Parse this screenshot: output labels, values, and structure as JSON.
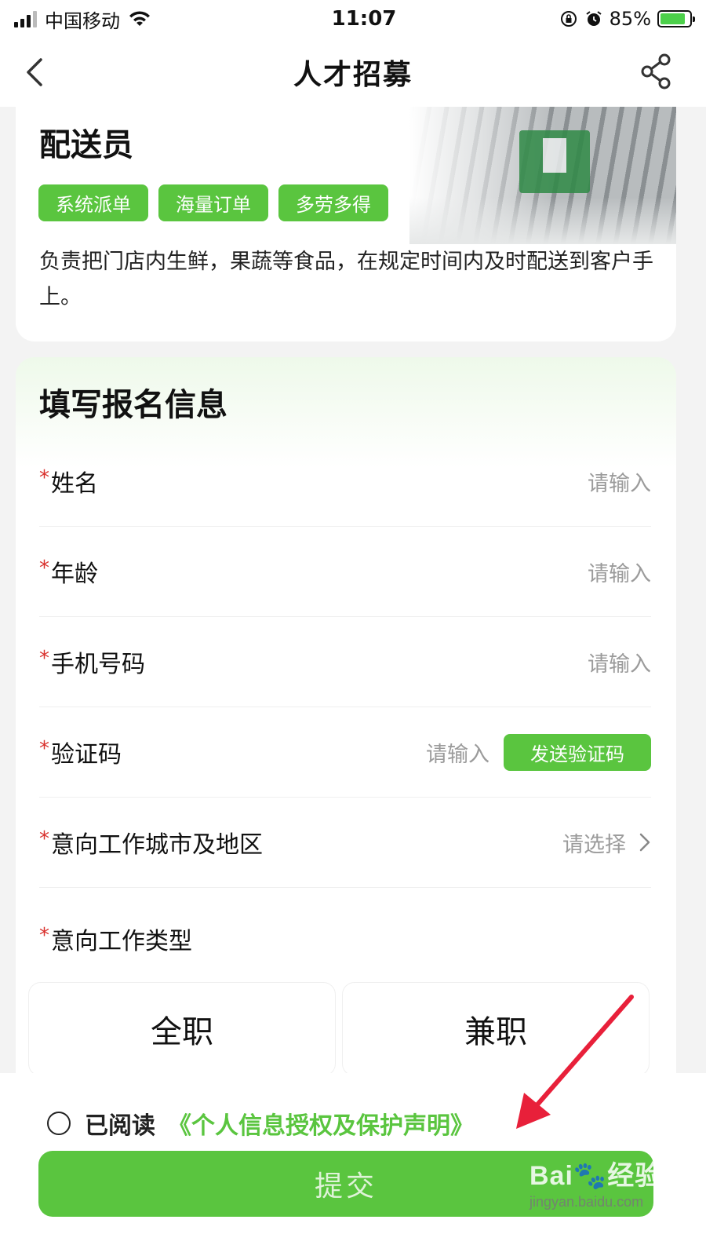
{
  "status_bar": {
    "carrier": "中国移动",
    "time": "11:07",
    "battery": "85%",
    "battery_level": 0.85
  },
  "nav": {
    "title": "人才招募",
    "back_icon": "chevron-left-icon",
    "share_icon": "share-icon"
  },
  "job": {
    "title": "配送员",
    "tags": [
      "系统派单",
      "海量订单",
      "多劳多得"
    ],
    "description": "负责把门店内生鲜，果蔬等食品，在规定时间内及时配送到客户手上。"
  },
  "form": {
    "title": "填写报名信息",
    "required_mark": "*",
    "fields": [
      {
        "label": "姓名",
        "placeholder": "请输入"
      },
      {
        "label": "年龄",
        "placeholder": "请输入"
      },
      {
        "label": "手机号码",
        "placeholder": "请输入"
      },
      {
        "label": "验证码",
        "placeholder": "请输入",
        "button": "发送验证码"
      },
      {
        "label": "意向工作城市及地区",
        "placeholder": "请选择"
      }
    ],
    "work_type": {
      "label": "意向工作类型",
      "options": [
        "全职",
        "兼职"
      ]
    }
  },
  "footer": {
    "agree_text": "已阅读",
    "agree_link": "《个人信息授权及保护声明》",
    "submit": "提交"
  },
  "colors": {
    "accent": "#5ac53f",
    "required": "#d9322e",
    "annotation_arrow": "#e8203a"
  },
  "watermark": {
    "main": "Bai🐾经验",
    "sub": "jingyan.baidu.com"
  }
}
